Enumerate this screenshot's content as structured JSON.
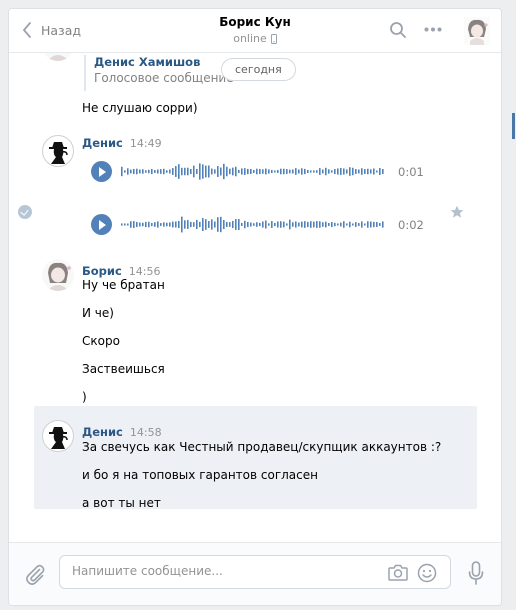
{
  "header": {
    "back_label": "Назад",
    "contact_name": "Борис Кун",
    "contact_status": "online"
  },
  "forwarded": {
    "author": "Денис Хамишов",
    "subtitle": "Голосовое сообщение"
  },
  "date_pill": "сегодня",
  "messages": {
    "pre_line": "Не слушаю сорри)",
    "group1": {
      "author": "Денис",
      "time": "14:49",
      "voice": [
        {
          "duration": "0:01"
        },
        {
          "duration": "0:02"
        }
      ]
    },
    "group2": {
      "author": "Борис",
      "time": "14:56",
      "lines": [
        "Ну че братан",
        "И че)",
        "Скоро",
        "Заствеишься",
        ")"
      ]
    },
    "group3": {
      "author": "Денис",
      "time": "14:58",
      "lines": [
        "За свечусь как Честный продавец/скупщик аккаунтов :?",
        "и бо я на топовых гарантов согласен",
        "а вот ты нет"
      ]
    }
  },
  "composer": {
    "placeholder": "Напишите сообщение..."
  },
  "colors": {
    "accent": "#5181b8",
    "link": "#2a5885",
    "selected_bg": "#edf0f5"
  },
  "icons": [
    "chevron-left-icon",
    "mobile-icon",
    "search-icon",
    "more-icon",
    "paperclip-icon",
    "camera-icon",
    "smile-icon",
    "microphone-icon",
    "check-icon",
    "star-icon",
    "play-icon"
  ]
}
